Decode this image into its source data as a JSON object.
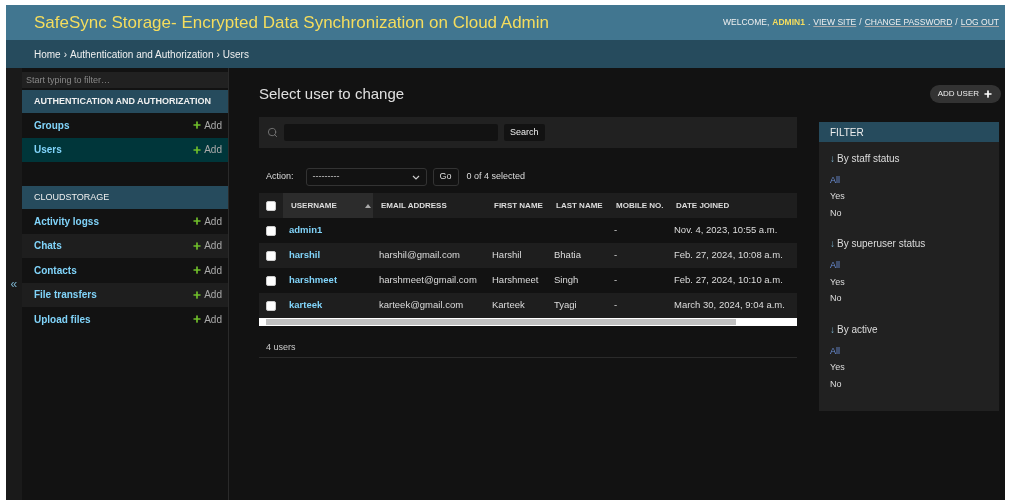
{
  "header": {
    "title": "SafeSync Storage- Encrypted Data Synchronization on Cloud Admin",
    "welcome": "WELCOME,",
    "user": "ADMIN1",
    "links": [
      "VIEW SITE",
      "CHANGE PASSWORD",
      "LOG OUT"
    ],
    "separators": [
      ".",
      "/",
      "/"
    ]
  },
  "breadcrumbs": [
    {
      "label": "Home"
    },
    {
      "label": "Authentication and Authorization",
      "sep": "›"
    },
    {
      "label": "Users",
      "sep": "›"
    }
  ],
  "sidebar": {
    "filter_placeholder": "Start typing to filter…",
    "toggle": "«",
    "apps": [
      {
        "name": "AUTHENTICATION AND AUTHORIZATION",
        "bold": true,
        "models": [
          {
            "name": "Groups",
            "add": "Add",
            "selected": false
          },
          {
            "name": "Users",
            "add": "Add",
            "selected": true
          }
        ]
      },
      {
        "name": "CLOUDSTORAGE",
        "bold": false,
        "models": [
          {
            "name": "Activity logss",
            "add": "Add",
            "selected": false
          },
          {
            "name": "Chats",
            "add": "Add",
            "selected": false
          },
          {
            "name": "Contacts",
            "add": "Add",
            "selected": false
          },
          {
            "name": "File transfers",
            "add": "Add",
            "selected": false
          },
          {
            "name": "Upload files",
            "add": "Add",
            "selected": false
          }
        ]
      }
    ]
  },
  "content": {
    "title": "Select user to change",
    "add_button": "ADD USER",
    "search_button": "Search",
    "action_label": "Action:",
    "action_value": "---------",
    "go": "Go",
    "selected_count": "0 of 4 selected",
    "footer": "4 users"
  },
  "table": {
    "select_all_checked": false,
    "columns": [
      {
        "label": "USERNAME",
        "sorted": true
      },
      {
        "label": "EMAIL ADDRESS",
        "sorted": false
      },
      {
        "label": "FIRST NAME",
        "sorted": false
      },
      {
        "label": "LAST NAME",
        "sorted": false
      },
      {
        "label": "MOBILE NO.",
        "sorted": false
      },
      {
        "label": "DATE JOINED",
        "sorted": false
      }
    ],
    "rows": [
      {
        "checked": false,
        "cells": [
          "admin1",
          "",
          "",
          "",
          "-",
          "Nov. 4, 2023, 10:55 a.m."
        ]
      },
      {
        "checked": false,
        "cells": [
          "harshil",
          "harshil@gmail.com",
          "Harshil",
          "Bhatia",
          "-",
          "Feb. 27, 2024, 10:08 a.m."
        ]
      },
      {
        "checked": false,
        "cells": [
          "harshmeet",
          "harshmeet@gmail.com",
          "Harshmeet",
          "Singh",
          "-",
          "Feb. 27, 2024, 10:10 a.m."
        ]
      },
      {
        "checked": false,
        "cells": [
          "karteek",
          "karteek@gmail.com",
          "Karteek",
          "Tyagi",
          "-",
          "March 30, 2024, 9:04 a.m."
        ]
      }
    ]
  },
  "filter": {
    "title": "FILTER",
    "groups": [
      {
        "arrow": "↓",
        "title": "By staff status",
        "options": [
          {
            "label": "All",
            "selected": true
          },
          {
            "label": "Yes",
            "selected": false
          },
          {
            "label": "No",
            "selected": false
          }
        ]
      },
      {
        "arrow": "↓",
        "title": "By superuser status",
        "options": [
          {
            "label": "All",
            "selected": true
          },
          {
            "label": "Yes",
            "selected": false
          },
          {
            "label": "No",
            "selected": false
          }
        ]
      },
      {
        "arrow": "↓",
        "title": "By active",
        "options": [
          {
            "label": "All",
            "selected": true
          },
          {
            "label": "Yes",
            "selected": false
          },
          {
            "label": "No",
            "selected": false
          }
        ]
      }
    ]
  }
}
